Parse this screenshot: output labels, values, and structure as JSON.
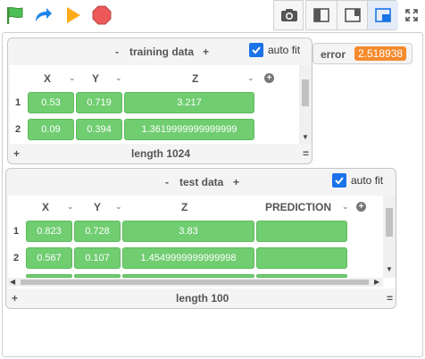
{
  "toolbar": {
    "green_flag_icon": "green-flag-icon",
    "redo_icon": "redo-arrow-icon",
    "play_icon": "play-icon",
    "stop_icon": "stop-icon",
    "camera_icon": "camera-icon",
    "layout_left_icon": "layout-left-icon",
    "layout_right_icon": "layout-right-icon",
    "layout_corner_icon": "layout-corner-icon",
    "fullscreen_icon": "fullscreen-icon"
  },
  "training": {
    "minus": "-",
    "title": "training data",
    "plus": "+",
    "autofit_label": "auto fit",
    "columns": [
      "X",
      "Y",
      "Z"
    ],
    "rows": [
      {
        "num": "1",
        "cells": [
          "0.53",
          "0.719",
          "3.217"
        ]
      },
      {
        "num": "2",
        "cells": [
          "0.09",
          "0.394",
          "1.3619999999999999"
        ]
      }
    ],
    "footer_plus": "+",
    "footer_label": "length 1024",
    "footer_eq": "="
  },
  "test": {
    "minus": "-",
    "title": "test data",
    "plus": "+",
    "autofit_label": "auto fit",
    "columns": [
      "X",
      "Y",
      "Z",
      "PREDICTION"
    ],
    "rows": [
      {
        "num": "1",
        "cells": [
          "0.823",
          "0.728",
          "3.83",
          ""
        ]
      },
      {
        "num": "2",
        "cells": [
          "0.567",
          "0.107",
          "1.4549999999999998",
          ""
        ]
      }
    ],
    "footer_plus": "+",
    "footer_label": "length 100",
    "footer_eq": "="
  },
  "error": {
    "label": "error",
    "value": "2.518938"
  },
  "colors": {
    "cell_green": "#70cd70",
    "accent_blue": "#1a73e8",
    "error_orange": "#f58a2c",
    "flag_green": "#4cbf56",
    "stop_red": "#ec5959",
    "play_orange": "#ffab19"
  }
}
